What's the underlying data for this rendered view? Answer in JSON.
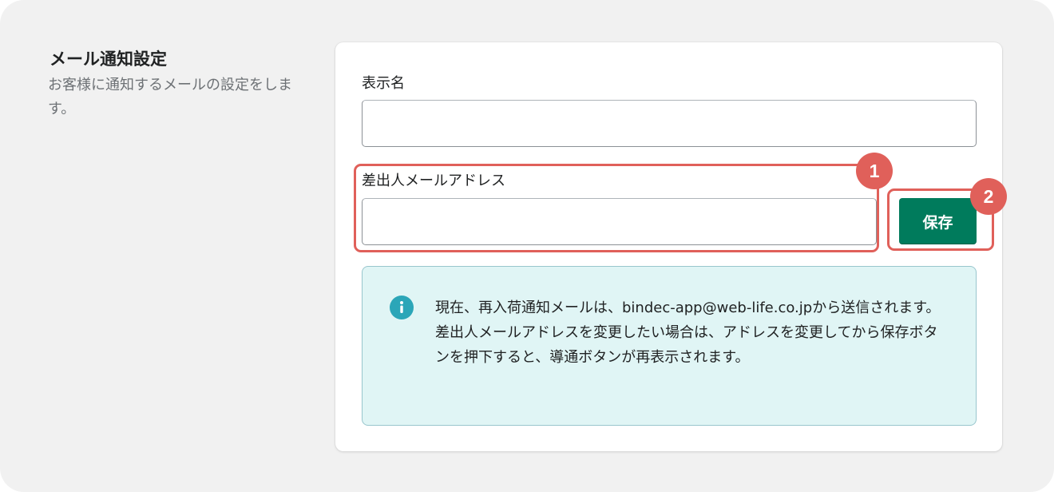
{
  "section": {
    "title": "メール通知設定",
    "description": "お客様に通知するメールの設定をします。"
  },
  "form": {
    "display_name": {
      "label": "表示名",
      "value": ""
    },
    "sender_email": {
      "label": "差出人メールアドレス",
      "value": ""
    },
    "save_label": "保存"
  },
  "banner": {
    "icon": "info-icon",
    "text": "現在、再入荷通知メールは、bindec-app@web-life.co.jpから送信されます。差出人メールアドレスを変更したい場合は、アドレスを変更してから保存ボタンを押下すると、導通ボタンが再表示されます。"
  },
  "callouts": [
    "1",
    "2"
  ],
  "colors": {
    "primary": "#007b5c",
    "highlight": "#e0605a",
    "info_bg": "#e0f5f5",
    "info_icon": "#2ba6b8"
  }
}
